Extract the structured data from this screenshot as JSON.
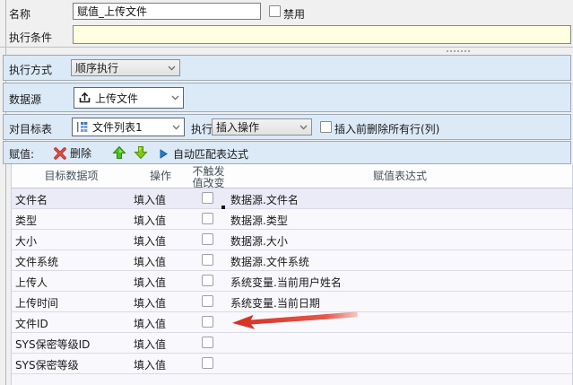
{
  "form": {
    "name_label": "名称",
    "name_value": "赋值_上传文件",
    "disable_label": "禁用",
    "condition_label": "执行条件",
    "condition_value": "",
    "exec_mode_label": "执行方式",
    "exec_mode_value": "顺序执行",
    "datasource_label": "数据源",
    "datasource_value": "上传文件",
    "target_table_label": "对目标表",
    "target_table_value": "文件列表1",
    "exec_label": "执行",
    "exec_op_value": "插入操作",
    "delete_before_label": "插入前删除所有行(列)"
  },
  "toolbar": {
    "assign_label": "赋值:",
    "delete_label": "删除",
    "auto_match_label": "自动匹配表达式"
  },
  "table": {
    "headers": {
      "item": "目标数据项",
      "op": "操作",
      "trigger1": "不触发",
      "trigger2": "值改变",
      "expr": "赋值表达式"
    },
    "rows": [
      {
        "item": "文件名",
        "op": "填入值",
        "expr": "数据源.文件名"
      },
      {
        "item": "类型",
        "op": "填入值",
        "expr": "数据源.类型"
      },
      {
        "item": "大小",
        "op": "填入值",
        "expr": "数据源.大小"
      },
      {
        "item": "文件系统",
        "op": "填入值",
        "expr": "数据源.文件系统"
      },
      {
        "item": "上传人",
        "op": "填入值",
        "expr": "系统变量.当前用户姓名"
      },
      {
        "item": "上传时间",
        "op": "填入值",
        "expr": "系统变量.当前日期"
      },
      {
        "item": "文件ID",
        "op": "填入值",
        "expr": ""
      },
      {
        "item": "SYS保密等级ID",
        "op": "填入值",
        "expr": ""
      },
      {
        "item": "SYS保密等级",
        "op": "填入值",
        "expr": ""
      }
    ]
  },
  "colors": {
    "section_blue": "#dce9f7",
    "condition_yellow": "#ffffe1",
    "page_gray": "#f0f0f0",
    "annotation_arrow_red": "#d93025",
    "delete_x_red": "#c03028",
    "move_arrow_green": "#3aa413",
    "play_blue": "#1f7fd4"
  }
}
